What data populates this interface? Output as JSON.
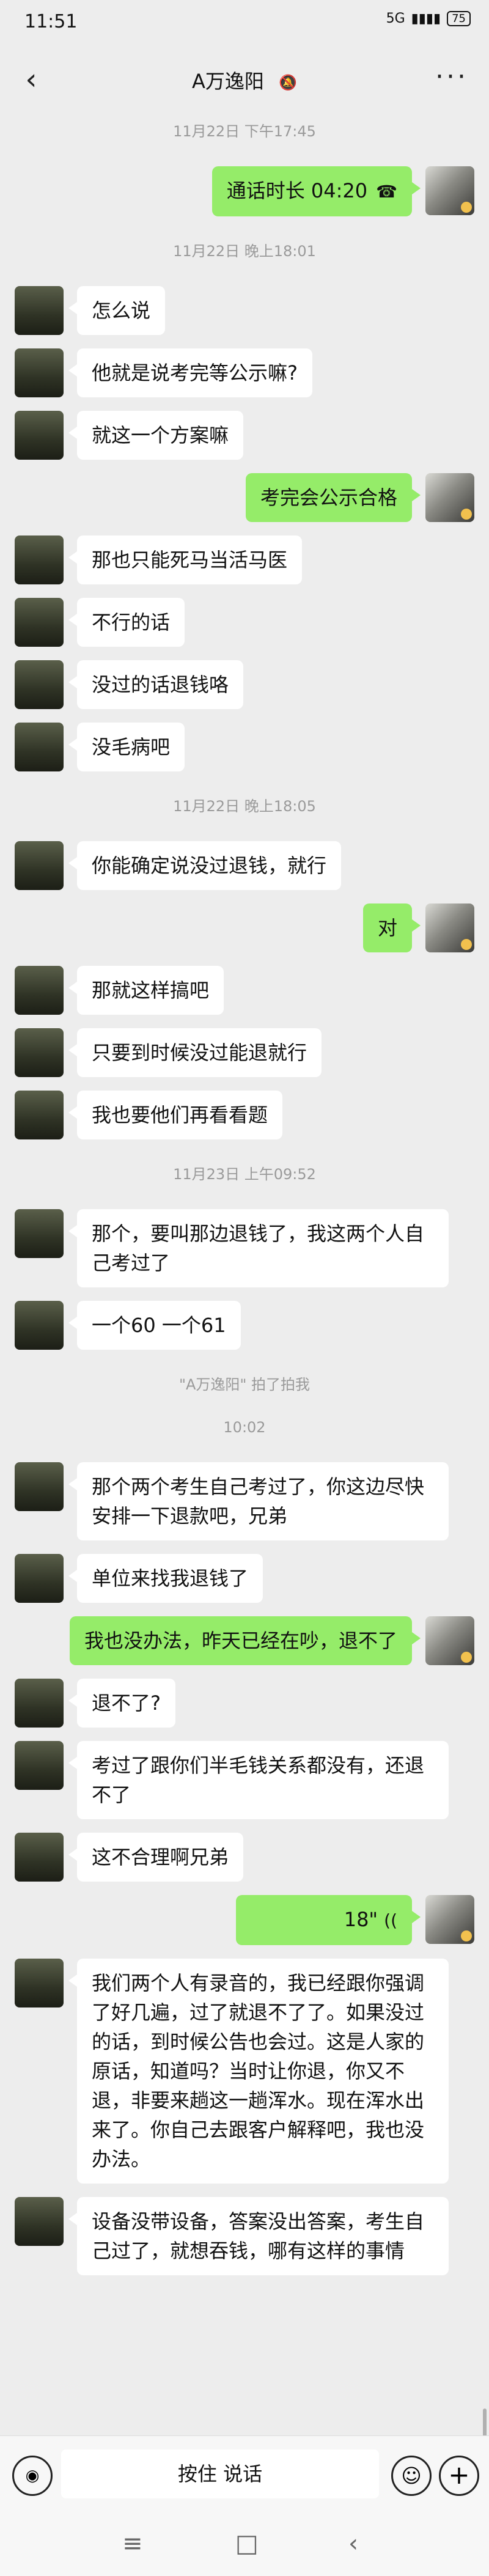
{
  "status": {
    "time": "11:51",
    "network": "5G",
    "battery": "75"
  },
  "header": {
    "back": "‹",
    "title": "A万逸阳",
    "mute_icon": "bell-off-icon",
    "more": "···"
  },
  "messages": [
    {
      "type": "time",
      "text": "11月22日 下午17:45"
    },
    {
      "type": "call",
      "side": "right",
      "text": "通话时长 04:20",
      "icon": "☎"
    },
    {
      "type": "time",
      "text": "11月22日 晚上18:01"
    },
    {
      "type": "text",
      "side": "left",
      "text": "怎么说"
    },
    {
      "type": "text",
      "side": "left",
      "text": "他就是说考完等公示嘛?"
    },
    {
      "type": "text",
      "side": "left",
      "text": "就这一个方案嘛"
    },
    {
      "type": "text",
      "side": "right",
      "text": "考完会公示合格"
    },
    {
      "type": "text",
      "side": "left",
      "text": "那也只能死马当活马医"
    },
    {
      "type": "text",
      "side": "left",
      "text": "不行的话"
    },
    {
      "type": "text",
      "side": "left",
      "text": "没过的话退钱咯"
    },
    {
      "type": "text",
      "side": "left",
      "text": "没毛病吧"
    },
    {
      "type": "time",
      "text": "11月22日 晚上18:05"
    },
    {
      "type": "text",
      "side": "left",
      "text": "你能确定说没过退钱，就行"
    },
    {
      "type": "text",
      "side": "right",
      "text": "对"
    },
    {
      "type": "text",
      "side": "left",
      "text": "那就这样搞吧"
    },
    {
      "type": "text",
      "side": "left",
      "text": "只要到时候没过能退就行"
    },
    {
      "type": "text",
      "side": "left",
      "text": "我也要他们再看看题"
    },
    {
      "type": "time",
      "text": "11月23日 上午09:52"
    },
    {
      "type": "text",
      "side": "left",
      "text": "那个，要叫那边退钱了，我这两个人自己考过了"
    },
    {
      "type": "text",
      "side": "left",
      "text": "一个60  一个61"
    },
    {
      "type": "note",
      "text": "\"A万逸阳\" 拍了拍我"
    },
    {
      "type": "time",
      "text": "10:02"
    },
    {
      "type": "text",
      "side": "left",
      "text": "那个两个考生自己考过了，你这边尽快安排一下退款吧，兄弟"
    },
    {
      "type": "text",
      "side": "left",
      "text": "单位来找我退钱了"
    },
    {
      "type": "text",
      "side": "right",
      "text": "我也没办法，昨天已经在吵，退不了"
    },
    {
      "type": "text",
      "side": "left",
      "text": "退不了?"
    },
    {
      "type": "text",
      "side": "left",
      "text": "考过了跟你们半毛钱关系都没有，还退不了"
    },
    {
      "type": "text",
      "side": "left",
      "text": "这不合理啊兄弟"
    },
    {
      "type": "voice",
      "side": "right",
      "text": "18\"",
      "icon": "wave"
    },
    {
      "type": "text",
      "side": "left",
      "text": "我们两个人有录音的，我已经跟你强调了好几遍，过了就退不了了。如果没过的话，到时候公告也会过。这是人家的原话，知道吗？当时让你退，你又不退，非要来趟这一趟浑水。现在浑水出来了。你自己去跟客户解释吧，我也没办法。"
    },
    {
      "type": "text",
      "side": "left",
      "text": "设备没带设备，答案没出答案，考生自己过了，就想吞钱，哪有这样的事情"
    }
  ],
  "input": {
    "voice_icon": "voice-icon",
    "hold_to_talk": "按住 说话",
    "emoji_icon": "emoji-icon",
    "plus_icon": "plus-icon"
  },
  "sysnav": {
    "menu": "≡",
    "home": "□",
    "back": "‹"
  }
}
